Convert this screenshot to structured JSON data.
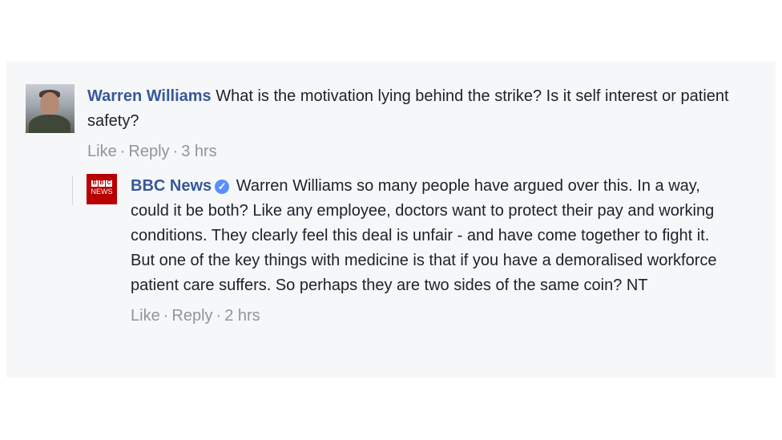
{
  "comments": [
    {
      "author": "Warren Williams",
      "text": "What is the motivation lying behind the strike? Is it self interest or patient safety?",
      "like_label": "Like",
      "reply_label": "Reply",
      "separator": "·",
      "time": "3 hrs",
      "avatar_icon": "user-photo-avatar"
    },
    {
      "author": "BBC News",
      "verified_icon": "verified-badge-icon",
      "text": "Warren Williams so many people have argued over this. In a way, could it be both? Like any employee, doctors want to protect their pay and working conditions. They clearly feel this deal is unfair - and have come together to fight it. But one of the key things with medicine is that if you have a demoralised workforce patient care suffers. So perhaps they are two sides of the same coin? NT",
      "like_label": "Like",
      "reply_label": "Reply",
      "separator": "·",
      "time": "2 hrs",
      "logo_letters": [
        "B",
        "B",
        "C"
      ],
      "logo_word": "NEWS"
    }
  ],
  "colors": {
    "panel_bg": "#f6f7f9",
    "name": "#365899",
    "text": "#1d2129",
    "meta": "#90949c",
    "bbc_red": "#b80000",
    "verified": "#5890ff"
  }
}
